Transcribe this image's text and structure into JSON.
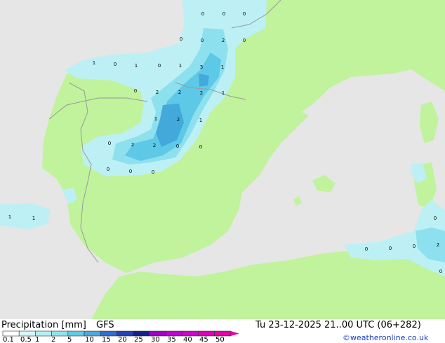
{
  "title": "Precipitation [mm]",
  "model": "GFS",
  "valid_time": "Tu 23-12-2025 21..00 UTC (06+282)",
  "credit": "©weatheronline.co.uk",
  "colors": {
    "sea": "#e6e6e6",
    "land": "#c0f39c",
    "border": "#999999",
    "precip_light": "#bdf0f4",
    "precip_medium": "#8de0ee",
    "precip_heavy": "#5ec9e6",
    "precip_core": "#43a9db"
  },
  "legend": {
    "ticks": [
      "0.1",
      "0.5",
      "1",
      "2",
      "5",
      "10",
      "15",
      "20",
      "25",
      "30",
      "35",
      "40",
      "45",
      "50"
    ],
    "colors": [
      "#ffffff",
      "#d6f7f9",
      "#b4eff4",
      "#8fe4ee",
      "#5fcbe6",
      "#4aa9dd",
      "#2f6fd3",
      "#2442b6",
      "#17208c",
      "#a400c8",
      "#c000d4",
      "#d400cc",
      "#e000b8",
      "#e800a8"
    ]
  },
  "grid_values": [
    "0",
    "0",
    "0",
    "0",
    "0",
    "2",
    "0",
    "1",
    "0",
    "1",
    "0",
    "1",
    "3",
    "1",
    "0",
    "2",
    "2",
    "2",
    "1",
    "1",
    "2",
    "1",
    "0",
    "2",
    "2",
    "0",
    "0",
    "0",
    "0",
    "0",
    "1",
    "1",
    "0",
    "0",
    "0",
    "0",
    "2",
    "0"
  ]
}
